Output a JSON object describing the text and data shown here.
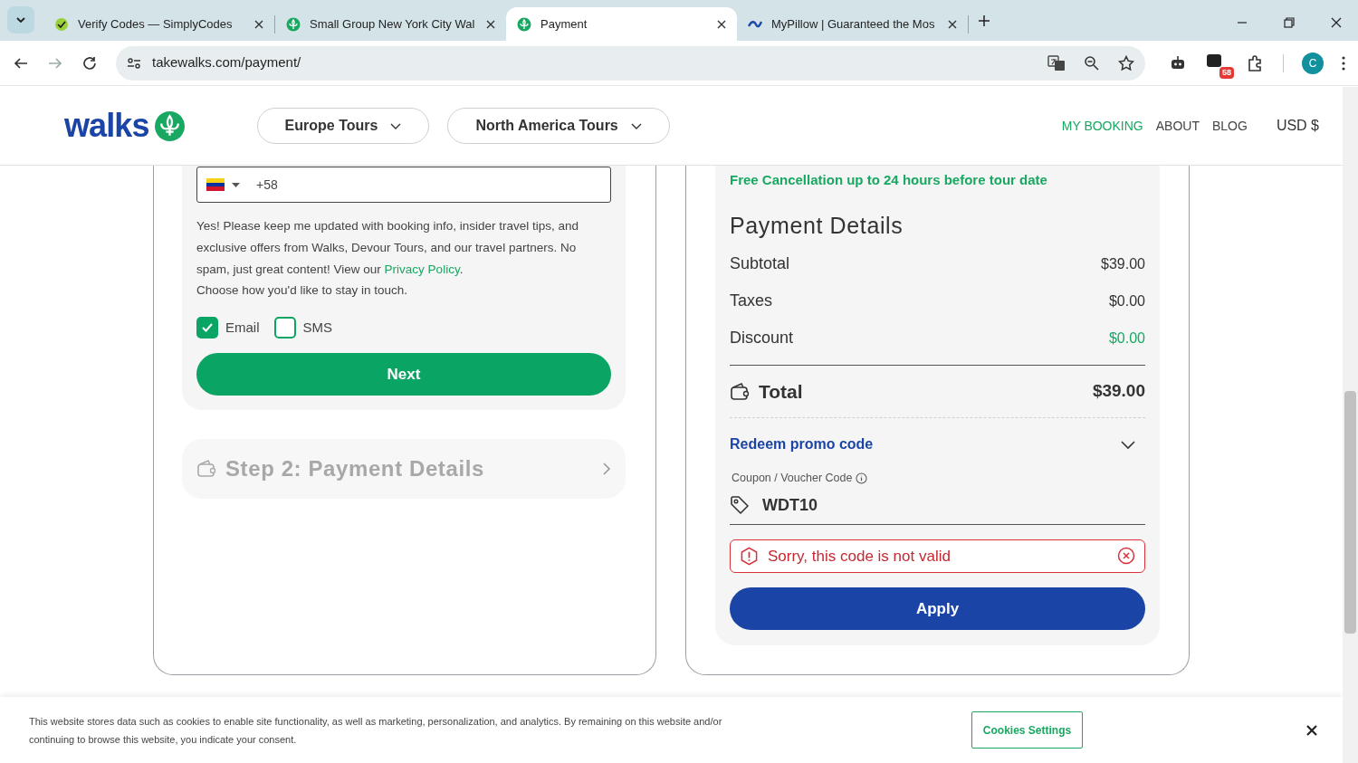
{
  "browser": {
    "tabs": [
      {
        "title": "Verify Codes — SimplyCodes",
        "kind": "check",
        "selected": false
      },
      {
        "title": "Small Group New York City Wal",
        "kind": "fleur",
        "selected": false
      },
      {
        "title": "Payment",
        "kind": "fleur",
        "selected": true
      },
      {
        "title": "MyPillow | Guaranteed the Mos",
        "kind": "wave",
        "selected": false
      }
    ],
    "url": "takewalks.com/payment/",
    "extension_badge": "58",
    "profile": "C"
  },
  "header": {
    "logo": "walks",
    "menus": [
      "Europe Tours",
      "North America Tours"
    ],
    "links": [
      {
        "label": "MY BOOKING",
        "selected": true
      },
      {
        "label": "ABOUT",
        "selected": false
      },
      {
        "label": "BLOG",
        "selected": false
      }
    ],
    "currency": "USD $"
  },
  "contact_form": {
    "phone_code": "+58",
    "consent": {
      "before": "Yes! Please keep me updated with booking info, insider travel tips, and exclusive offers from Walks, Devour Tours, and our travel partners. No spam, just great content! View our ",
      "link": "Privacy Policy",
      "after": "."
    },
    "choose_text": "Choose how you'd like to stay in touch.",
    "channels": [
      {
        "label": "Email",
        "checked": true
      },
      {
        "label": "SMS",
        "checked": false
      }
    ],
    "next_button": "Next",
    "step_2": "Step 2: Payment Details"
  },
  "summary": {
    "cancellation": "Free Cancellation up to 24 hours before tour date",
    "title": "Payment Details",
    "lines": [
      {
        "label": "Subtotal",
        "value": "$39.00",
        "kind": "plain"
      },
      {
        "label": "Taxes",
        "value": "$0.00",
        "kind": "plain"
      },
      {
        "label": "Discount",
        "value": "$0.00",
        "kind": "discount"
      }
    ],
    "total_label": "Total",
    "total_value": "$39.00",
    "promo": {
      "toggle": "Redeem promo code",
      "expanded": true,
      "field_label": "Coupon / Voucher Code",
      "code": "WDT10",
      "error": "Sorry, this code is not valid",
      "apply_button": "Apply"
    }
  },
  "cookie_banner": {
    "text": "This website stores data such as cookies to enable site functionality, as well as marketing, personalization, and analytics. By remaining on this website and/or continuing to browse this website, you indicate your consent.",
    "settings_button": "Cookies Settings"
  }
}
